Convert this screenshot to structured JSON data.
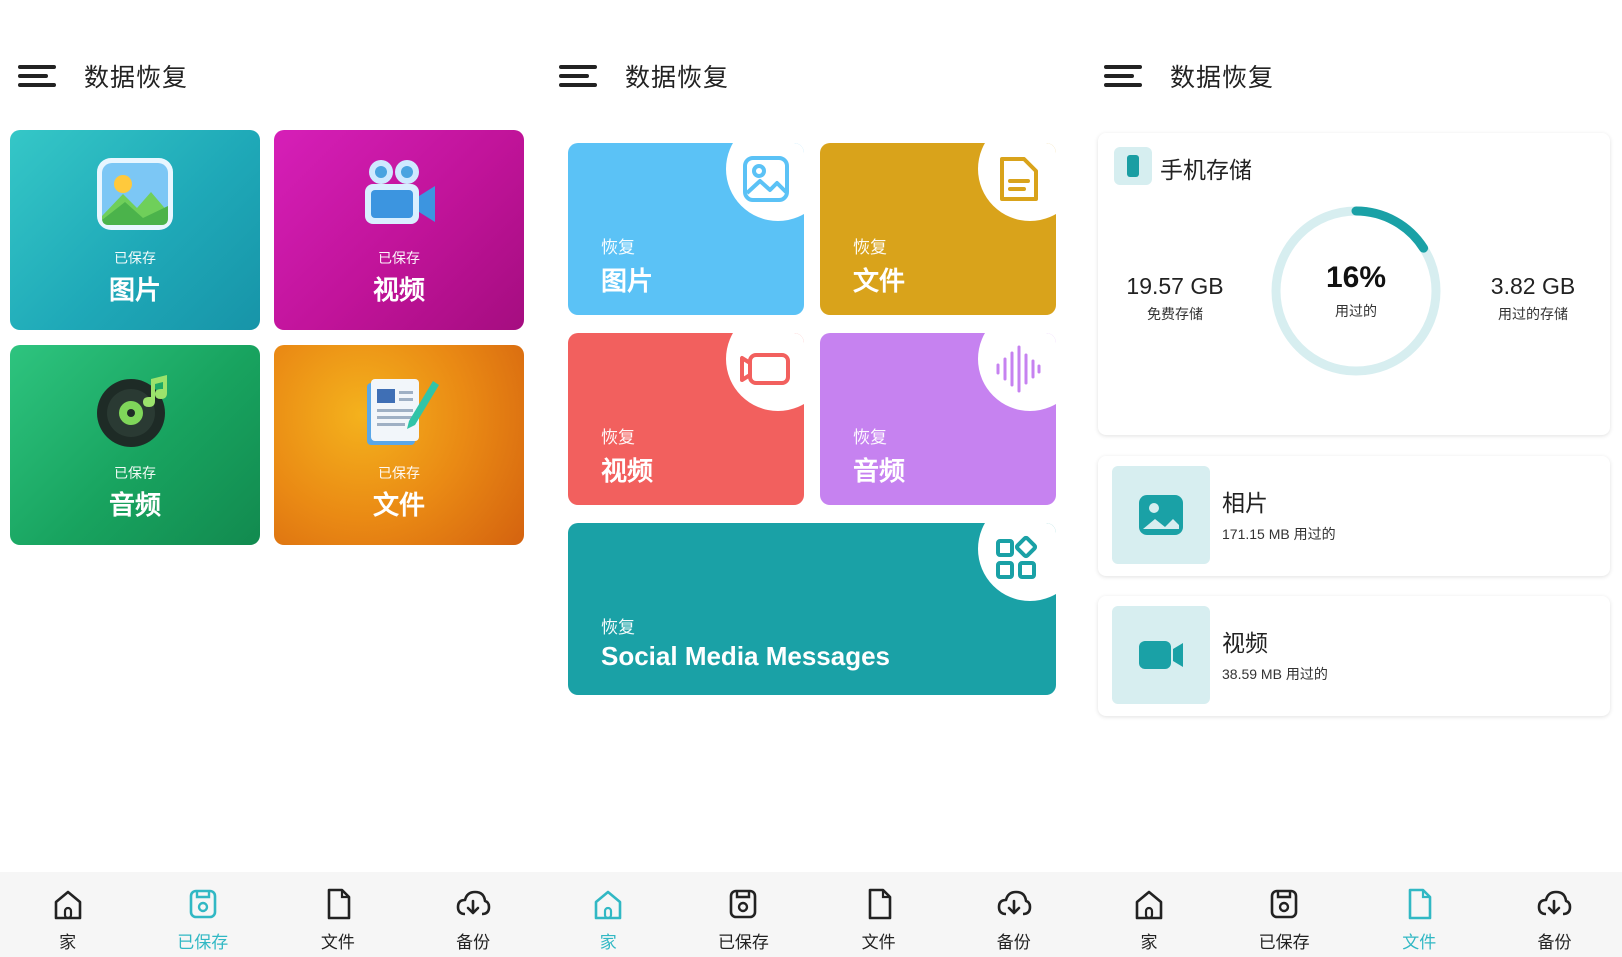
{
  "app_title": "数据恢复",
  "colors": {
    "accent": "#31b8c4",
    "teal": "#1aa1a6",
    "light_teal": "#d7eef0",
    "text": "#222222"
  },
  "panel1": {
    "tiles": [
      {
        "small": "已保存",
        "big": "图片",
        "icon": "photo-icon"
      },
      {
        "small": "已保存",
        "big": "视频",
        "icon": "video-camera-icon"
      },
      {
        "small": "已保存",
        "big": "音频",
        "icon": "music-disc-icon"
      },
      {
        "small": "已保存",
        "big": "文件",
        "icon": "document-icon"
      }
    ],
    "nav": [
      {
        "label": "家",
        "icon": "home-icon"
      },
      {
        "label": "已保存",
        "icon": "saved-icon"
      },
      {
        "label": "文件",
        "icon": "file-icon"
      },
      {
        "label": "备份",
        "icon": "cloud-download-icon"
      }
    ],
    "active_nav": "已保存"
  },
  "panel2": {
    "tiles": [
      {
        "small": "恢复",
        "big": "图片",
        "icon": "image-icon"
      },
      {
        "small": "恢复",
        "big": "文件",
        "icon": "file-icon"
      },
      {
        "small": "恢复",
        "big": "视频",
        "icon": "video-icon"
      },
      {
        "small": "恢复",
        "big": "音频",
        "icon": "audio-wave-icon"
      },
      {
        "small": "恢复",
        "big": "Social Media Messages",
        "icon": "apps-grid-icon"
      }
    ],
    "nav": [
      {
        "label": "家",
        "icon": "home-icon"
      },
      {
        "label": "已保存",
        "icon": "saved-icon"
      },
      {
        "label": "文件",
        "icon": "file-icon"
      },
      {
        "label": "备份",
        "icon": "cloud-download-icon"
      }
    ],
    "active_nav": "家"
  },
  "panel3": {
    "storage": {
      "title": "手机存储",
      "free_value": "19.57 GB",
      "free_label": "免费存储",
      "used_percent": "16%",
      "used_fraction": 0.16,
      "used_percent_label": "用过的",
      "used_value": "3.82 GB",
      "used_label": "用过的存储"
    },
    "media": [
      {
        "name": "相片",
        "size": "171.15 MB 用过的",
        "icon": "photo-icon"
      },
      {
        "name": "视频",
        "size": "38.59 MB 用过的",
        "icon": "video-icon"
      }
    ],
    "nav": [
      {
        "label": "家",
        "icon": "home-icon"
      },
      {
        "label": "已保存",
        "icon": "saved-icon"
      },
      {
        "label": "文件",
        "icon": "file-icon"
      },
      {
        "label": "备份",
        "icon": "cloud-download-icon"
      }
    ],
    "active_nav": "文件"
  }
}
